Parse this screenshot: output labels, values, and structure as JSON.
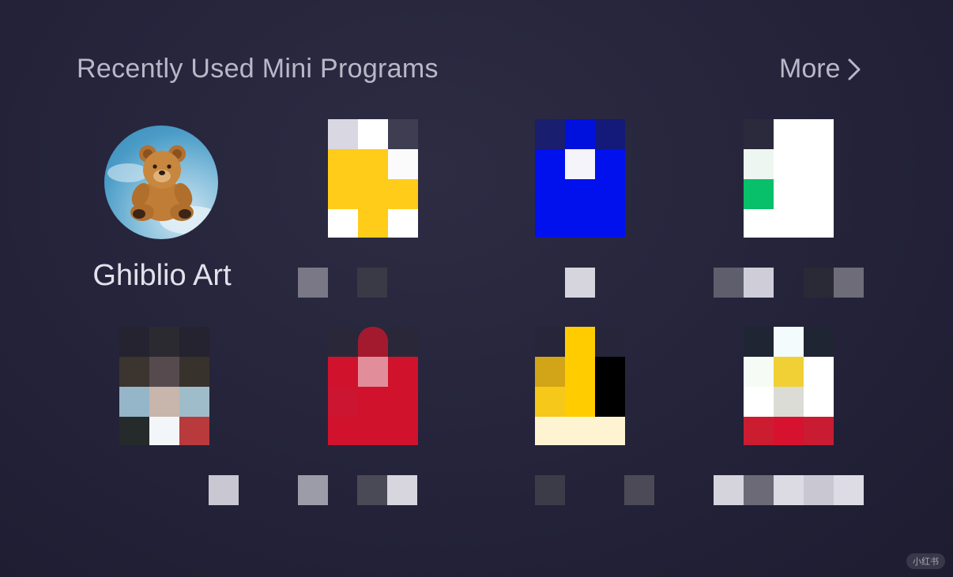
{
  "header": {
    "title": "Recently Used Mini Programs",
    "more_label": "More"
  },
  "apps": [
    {
      "name": "Ghiblio Art",
      "icon": "teddy-bear-icon"
    }
  ],
  "watermark": "小红书",
  "colors": {
    "background": "#24233a",
    "header_text": "#b9b8c8",
    "label_text": "#e3e2ec"
  }
}
